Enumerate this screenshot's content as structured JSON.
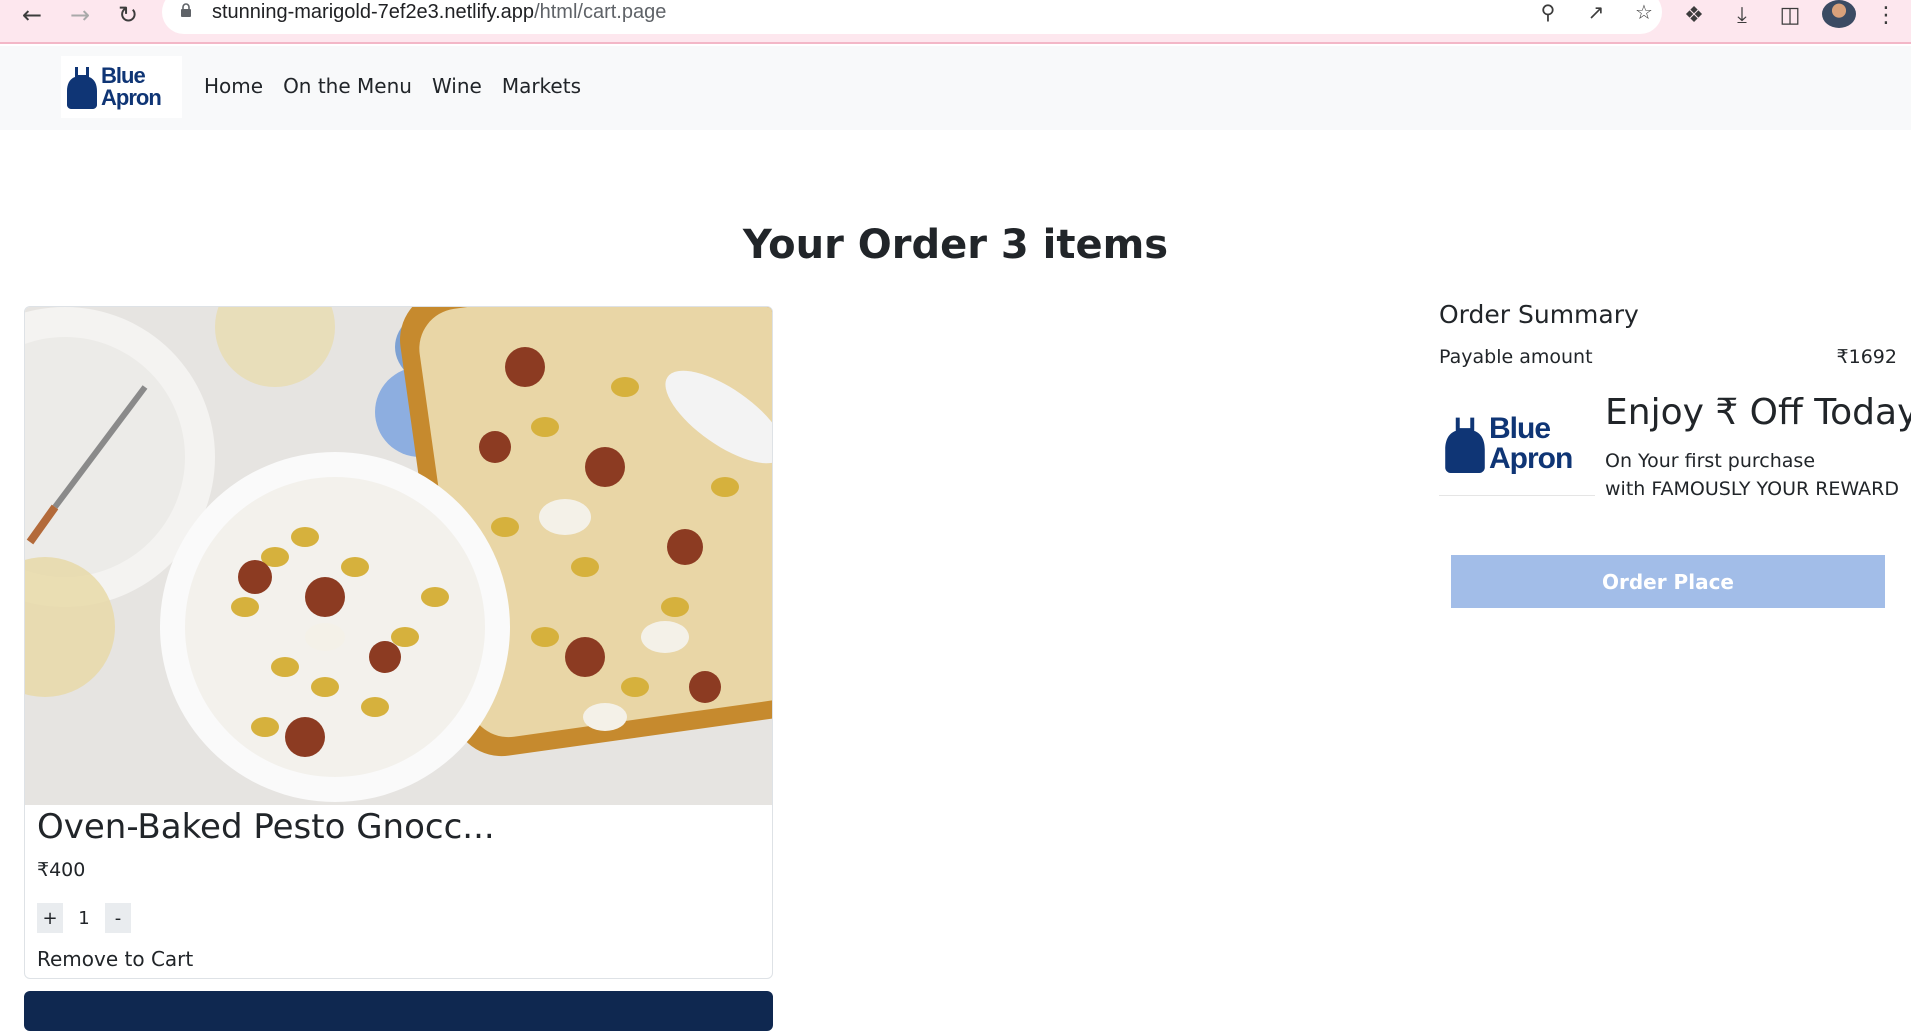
{
  "browser": {
    "url_host": "stunning-marigold-7ef2e3.netlify.app",
    "url_path": "/html/cart.page",
    "icons": [
      "back-icon",
      "forward-icon",
      "reload-icon",
      "lock-icon",
      "zoom-out-icon",
      "share-icon",
      "bookmark-star-icon",
      "extensions-icon",
      "download-icon",
      "side-panel-icon",
      "profile-avatar",
      "kebab-menu-icon"
    ]
  },
  "nav": {
    "logo_line1": "Blue",
    "logo_line2": "Apron",
    "links": [
      "Home",
      "On the Menu",
      "Wine",
      "Markets"
    ]
  },
  "page": {
    "title": "Your Order 3 items"
  },
  "cart": {
    "items": [
      {
        "title": "Oven-Baked Pesto Gnocc...",
        "price": "₹400",
        "plus_label": "+",
        "minus_label": "-",
        "quantity": "1",
        "remove_label": "Remove to Cart"
      }
    ]
  },
  "summary": {
    "title": "Order Summary",
    "payable_label": "Payable amount",
    "payable_value": "₹1692",
    "promo_logo_line1": "Blue",
    "promo_logo_line2": "Apron",
    "promo_headline": "Enjoy ₹ Off Today",
    "promo_line1": "On Your first purchase",
    "promo_line2": "with FAMOUSLY YOUR REWARD",
    "order_button": "Order Place"
  },
  "colors": {
    "brand_navy": "#0f3575",
    "order_button_bg": "#a2bde8",
    "chrome_bg": "#fde7ee"
  }
}
